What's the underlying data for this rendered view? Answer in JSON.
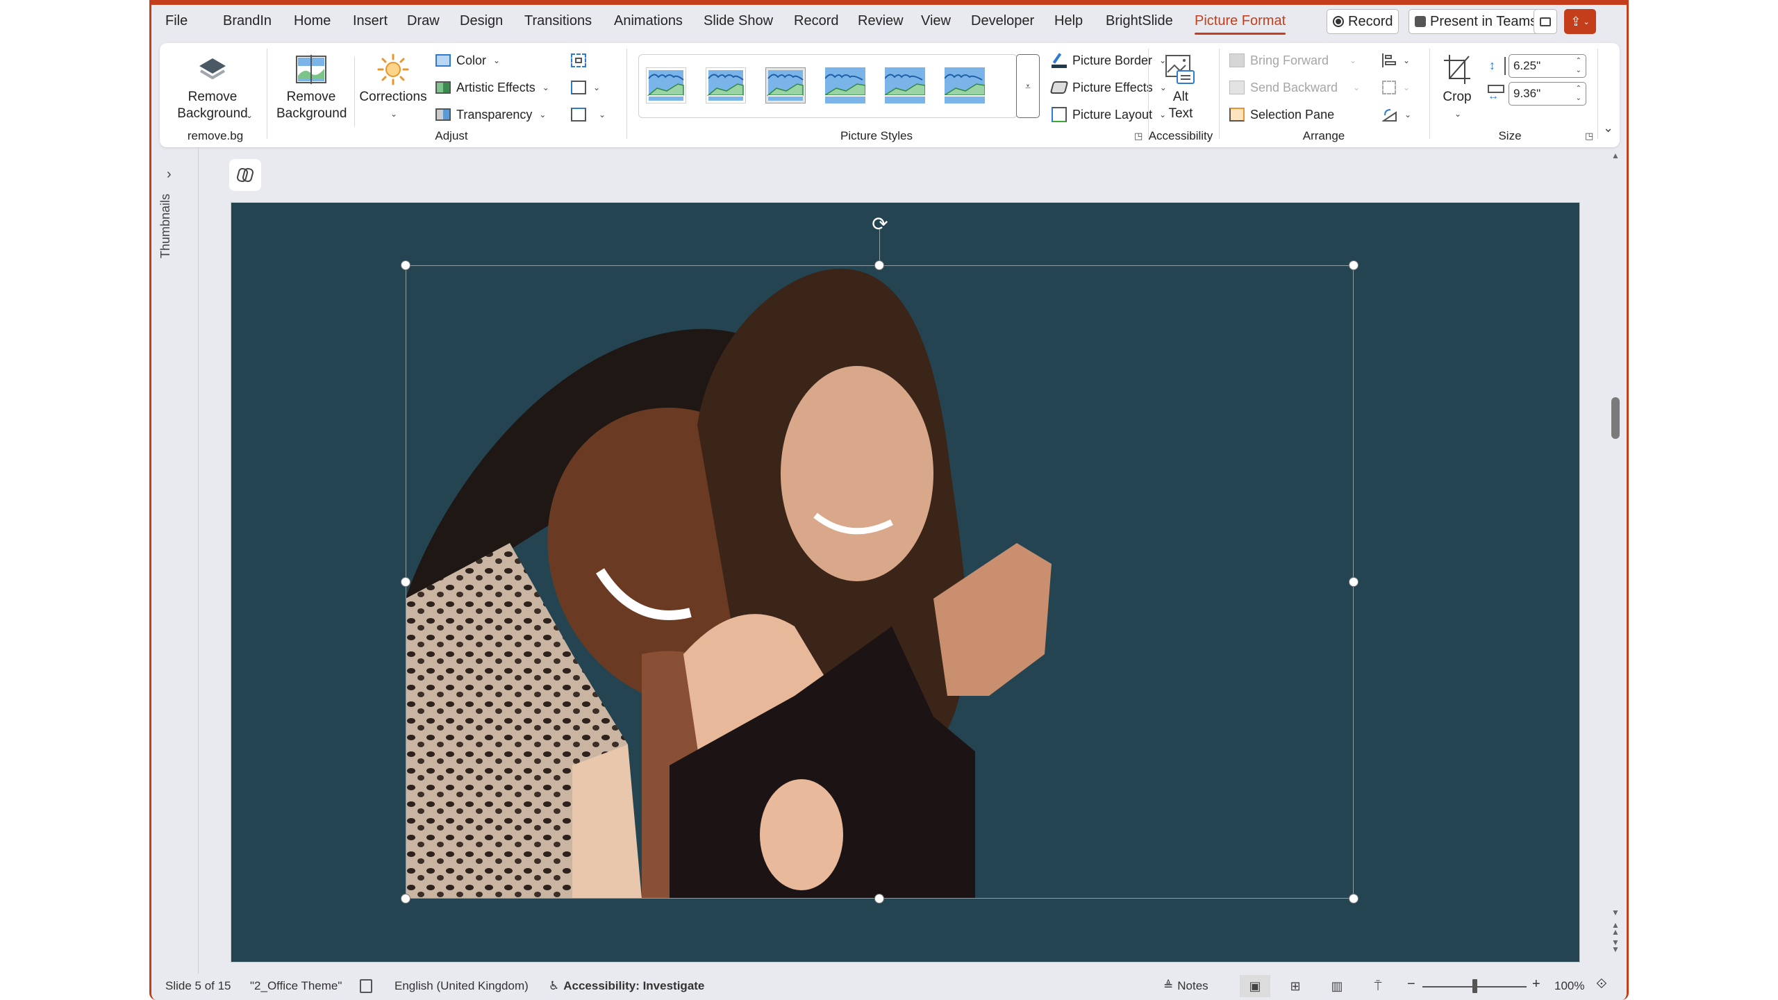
{
  "tabs": [
    "File",
    "BrandIn",
    "Home",
    "Insert",
    "Draw",
    "Design",
    "Transitions",
    "Animations",
    "Slide Show",
    "Record",
    "Review",
    "View",
    "Developer",
    "Help",
    "BrightSlide",
    "Picture Format"
  ],
  "active_tab": "Picture Format",
  "titlebar_buttons": {
    "record": "Record",
    "present_in_teams": "Present in Teams",
    "comments_icon": "comment-icon",
    "share_icon": "share-icon"
  },
  "ribbon": {
    "removebg_group": {
      "label": "remove.bg",
      "button": "Remove Background"
    },
    "adjust_group": {
      "label": "Adjust",
      "remove_background": "Remove Background",
      "corrections": "Corrections",
      "color": "Color",
      "artistic_effects": "Artistic Effects",
      "transparency": "Transparency",
      "compress_icon": "compress-pictures-icon",
      "change_picture_icon": "change-picture-icon",
      "reset_picture_icon": "reset-picture-icon"
    },
    "picture_styles_group": {
      "label": "Picture Styles",
      "style_count": 6,
      "picture_border": "Picture Border",
      "picture_effects": "Picture Effects",
      "picture_layout": "Picture Layout"
    },
    "accessibility_group": {
      "label": "Accessibility",
      "alt_text_line1": "Alt",
      "alt_text_line2": "Text"
    },
    "arrange_group": {
      "label": "Arrange",
      "bring_forward": "Bring Forward",
      "send_backward": "Send Backward",
      "selection_pane": "Selection Pane",
      "align_icon": "align-icon",
      "group_icon": "group-icon",
      "rotate_icon": "rotate-icon"
    },
    "size_group": {
      "label": "Size",
      "crop": "Crop",
      "height": "6.25\"",
      "width": "9.36\""
    }
  },
  "thumbnails_label": "Thumbnails",
  "slide": {
    "background_color": "#244451",
    "image_description": "Two women smiling, leaning heads together, background removed"
  },
  "statusbar": {
    "slide_info": "Slide 5 of 15",
    "theme": "\"2_Office Theme\"",
    "language": "English (United Kingdom)",
    "accessibility": "Accessibility: Investigate",
    "notes": "Notes",
    "zoom_level": "100%",
    "zoom_fraction": 0.5
  },
  "colors": {
    "accent": "#c43e1c",
    "chrome": "#e9eaef"
  }
}
